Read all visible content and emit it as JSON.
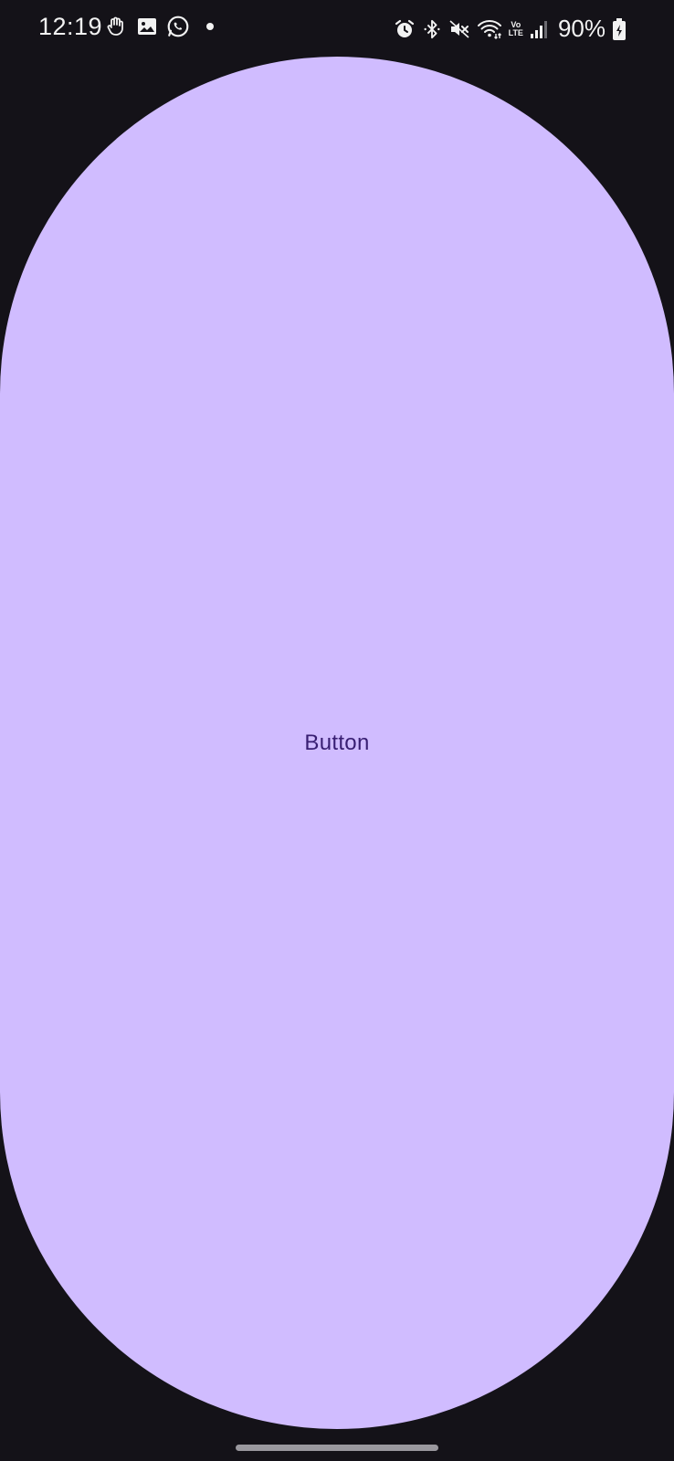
{
  "status_bar": {
    "time": "12:19",
    "notification_icons": [
      "hand-icon",
      "image-icon",
      "whatsapp-icon"
    ],
    "system_icons": [
      "alarm-icon",
      "bluetooth-icon",
      "mute-icon",
      "wifi-icon",
      "volte-icon",
      "signal-icon"
    ],
    "volte_label_top": "Vo",
    "volte_label_bottom": "LTE",
    "battery_percent": "90%"
  },
  "main": {
    "button_label": "Button"
  },
  "colors": {
    "background": "#141218",
    "button_fill": "#d0bcff",
    "button_text": "#381e72"
  }
}
